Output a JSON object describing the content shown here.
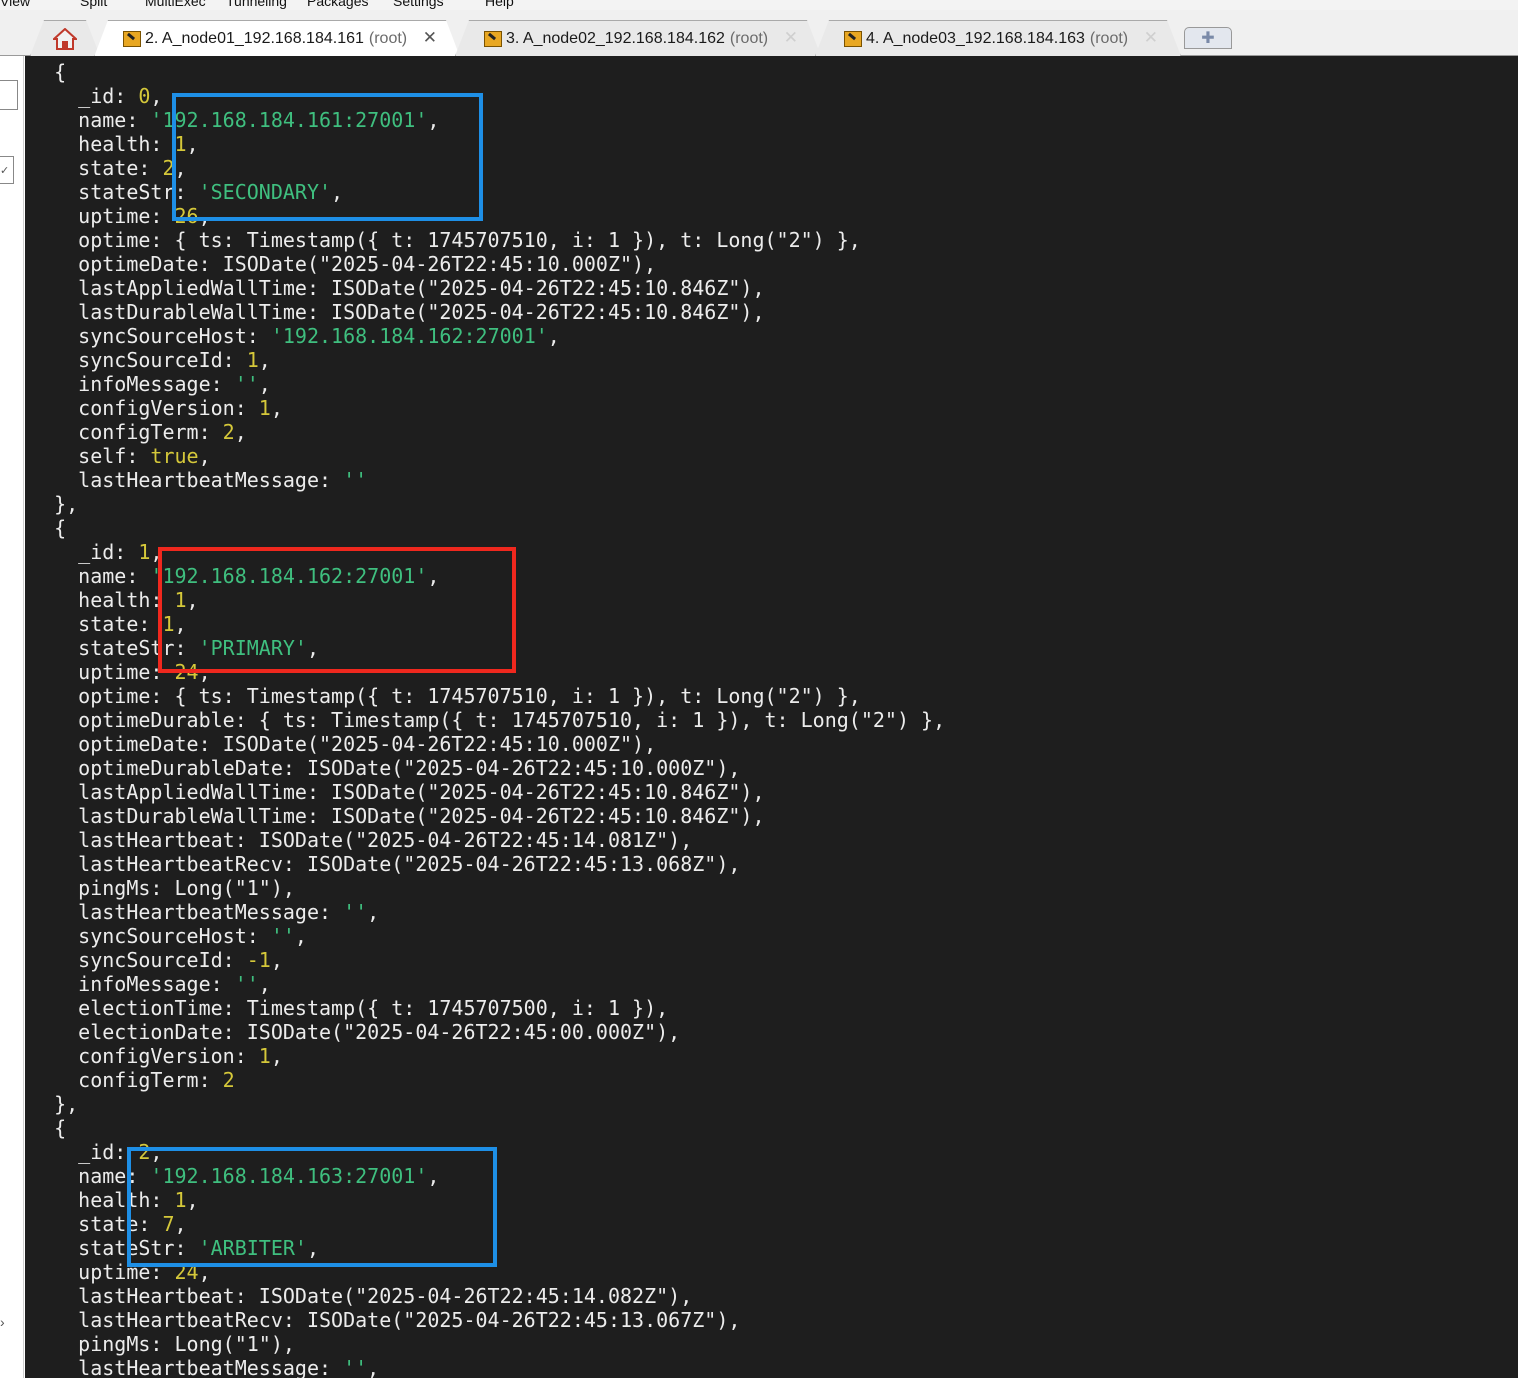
{
  "menu": [
    "View",
    "Split",
    "MultiExec",
    "Tunneling",
    "Packages",
    "Settings",
    "Help"
  ],
  "tabs": [
    {
      "label": "2. A_node01_192.168.184.161",
      "user": "(root)",
      "active": true
    },
    {
      "label": "3. A_node02_192.168.184.162",
      "user": "(root)",
      "active": false
    },
    {
      "label": "4. A_node03_192.168.184.163",
      "user": "(root)",
      "active": false
    }
  ],
  "icons": {
    "home": "home-icon",
    "tab": "terminal-session-icon",
    "close": "close-icon",
    "new_tab": "plus-icon"
  },
  "colors": {
    "terminal_bg": "#1e1e1e",
    "text": "#ececec",
    "string": "#3fbf7f",
    "number": "#d5c83a",
    "highlight_blue": "#1e8fe6",
    "highlight_red": "#f0281e"
  },
  "terminal_lines": [
    [
      [
        "  {",
        ""
      ]
    ],
    [
      [
        "    _id: ",
        ""
      ],
      [
        "0",
        "n"
      ],
      [
        ",",
        ""
      ]
    ],
    [
      [
        "    name: ",
        ""
      ],
      [
        "'192.168.184.161:27001'",
        "s"
      ],
      [
        ",",
        ""
      ]
    ],
    [
      [
        "    health: ",
        ""
      ],
      [
        "1",
        "n"
      ],
      [
        ",",
        ""
      ]
    ],
    [
      [
        "    state: ",
        ""
      ],
      [
        "2",
        "n"
      ],
      [
        ",",
        ""
      ]
    ],
    [
      [
        "    stateStr: ",
        ""
      ],
      [
        "'SECONDARY'",
        "s"
      ],
      [
        ",",
        ""
      ]
    ],
    [
      [
        "    uptime: ",
        ""
      ],
      [
        "26",
        "n"
      ],
      [
        ",",
        ""
      ]
    ],
    [
      [
        "    optime: { ts: Timestamp({ t: 1745707510, i: 1 }), t: Long(\"2\") },",
        ""
      ]
    ],
    [
      [
        "    optimeDate: ISODate(\"2025-04-26T22:45:10.000Z\"),",
        ""
      ]
    ],
    [
      [
        "    lastAppliedWallTime: ISODate(\"2025-04-26T22:45:10.846Z\"),",
        ""
      ]
    ],
    [
      [
        "    lastDurableWallTime: ISODate(\"2025-04-26T22:45:10.846Z\"),",
        ""
      ]
    ],
    [
      [
        "    syncSourceHost: ",
        ""
      ],
      [
        "'192.168.184.162:27001'",
        "s"
      ],
      [
        ",",
        ""
      ]
    ],
    [
      [
        "    syncSourceId: ",
        ""
      ],
      [
        "1",
        "n"
      ],
      [
        ",",
        ""
      ]
    ],
    [
      [
        "    infoMessage: ",
        ""
      ],
      [
        "''",
        "s"
      ],
      [
        ",",
        ""
      ]
    ],
    [
      [
        "    configVersion: ",
        ""
      ],
      [
        "1",
        "n"
      ],
      [
        ",",
        ""
      ]
    ],
    [
      [
        "    configTerm: ",
        ""
      ],
      [
        "2",
        "n"
      ],
      [
        ",",
        ""
      ]
    ],
    [
      [
        "    self: ",
        ""
      ],
      [
        "true",
        "k"
      ],
      [
        ",",
        ""
      ]
    ],
    [
      [
        "    lastHeartbeatMessage: ",
        ""
      ],
      [
        "''",
        "s"
      ]
    ],
    [
      [
        "  },",
        ""
      ]
    ],
    [
      [
        "  {",
        ""
      ]
    ],
    [
      [
        "    _id: ",
        ""
      ],
      [
        "1",
        "n"
      ],
      [
        ",",
        ""
      ]
    ],
    [
      [
        "    name: ",
        ""
      ],
      [
        "'192.168.184.162:27001'",
        "s"
      ],
      [
        ",",
        ""
      ]
    ],
    [
      [
        "    health: ",
        ""
      ],
      [
        "1",
        "n"
      ],
      [
        ",",
        ""
      ]
    ],
    [
      [
        "    state: ",
        ""
      ],
      [
        "1",
        "n"
      ],
      [
        ",",
        ""
      ]
    ],
    [
      [
        "    stateStr: ",
        ""
      ],
      [
        "'PRIMARY'",
        "s"
      ],
      [
        ",",
        ""
      ]
    ],
    [
      [
        "    uptime: ",
        ""
      ],
      [
        "24",
        "n"
      ],
      [
        ",",
        ""
      ]
    ],
    [
      [
        "    optime: { ts: Timestamp({ t: 1745707510, i: 1 }), t: Long(\"2\") },",
        ""
      ]
    ],
    [
      [
        "    optimeDurable: { ts: Timestamp({ t: 1745707510, i: 1 }), t: Long(\"2\") },",
        ""
      ]
    ],
    [
      [
        "    optimeDate: ISODate(\"2025-04-26T22:45:10.000Z\"),",
        ""
      ]
    ],
    [
      [
        "    optimeDurableDate: ISODate(\"2025-04-26T22:45:10.000Z\"),",
        ""
      ]
    ],
    [
      [
        "    lastAppliedWallTime: ISODate(\"2025-04-26T22:45:10.846Z\"),",
        ""
      ]
    ],
    [
      [
        "    lastDurableWallTime: ISODate(\"2025-04-26T22:45:10.846Z\"),",
        ""
      ]
    ],
    [
      [
        "    lastHeartbeat: ISODate(\"2025-04-26T22:45:14.081Z\"),",
        ""
      ]
    ],
    [
      [
        "    lastHeartbeatRecv: ISODate(\"2025-04-26T22:45:13.068Z\"),",
        ""
      ]
    ],
    [
      [
        "    pingMs: Long(\"1\"),",
        ""
      ]
    ],
    [
      [
        "    lastHeartbeatMessage: ",
        ""
      ],
      [
        "''",
        "s"
      ],
      [
        ",",
        ""
      ]
    ],
    [
      [
        "    syncSourceHost: ",
        ""
      ],
      [
        "''",
        "s"
      ],
      [
        ",",
        ""
      ]
    ],
    [
      [
        "    syncSourceId: ",
        ""
      ],
      [
        "-1",
        "n"
      ],
      [
        ",",
        ""
      ]
    ],
    [
      [
        "    infoMessage: ",
        ""
      ],
      [
        "''",
        "s"
      ],
      [
        ",",
        ""
      ]
    ],
    [
      [
        "    electionTime: Timestamp({ t: 1745707500, i: 1 }),",
        ""
      ]
    ],
    [
      [
        "    electionDate: ISODate(\"2025-04-26T22:45:00.000Z\"),",
        ""
      ]
    ],
    [
      [
        "    configVersion: ",
        ""
      ],
      [
        "1",
        "n"
      ],
      [
        ",",
        ""
      ]
    ],
    [
      [
        "    configTerm: ",
        ""
      ],
      [
        "2",
        "n"
      ]
    ],
    [
      [
        "  },",
        ""
      ]
    ],
    [
      [
        "  {",
        ""
      ]
    ],
    [
      [
        "    _id: ",
        ""
      ],
      [
        "2",
        "n"
      ],
      [
        ",",
        ""
      ]
    ],
    [
      [
        "    name: ",
        ""
      ],
      [
        "'192.168.184.163:27001'",
        "s"
      ],
      [
        ",",
        ""
      ]
    ],
    [
      [
        "    health: ",
        ""
      ],
      [
        "1",
        "n"
      ],
      [
        ",",
        ""
      ]
    ],
    [
      [
        "    state: ",
        ""
      ],
      [
        "7",
        "n"
      ],
      [
        ",",
        ""
      ]
    ],
    [
      [
        "    stateStr: ",
        ""
      ],
      [
        "'ARBITER'",
        "s"
      ],
      [
        ",",
        ""
      ]
    ],
    [
      [
        "    uptime: ",
        ""
      ],
      [
        "24",
        "n"
      ],
      [
        ",",
        ""
      ]
    ],
    [
      [
        "    lastHeartbeat: ISODate(\"2025-04-26T22:45:14.082Z\"),",
        ""
      ]
    ],
    [
      [
        "    lastHeartbeatRecv: ISODate(\"2025-04-26T22:45:13.067Z\"),",
        ""
      ]
    ],
    [
      [
        "    pingMs: Long(\"1\"),",
        ""
      ]
    ],
    [
      [
        "    lastHeartbeatMessage: ",
        ""
      ],
      [
        "''",
        "s"
      ],
      [
        ",",
        ""
      ]
    ]
  ]
}
